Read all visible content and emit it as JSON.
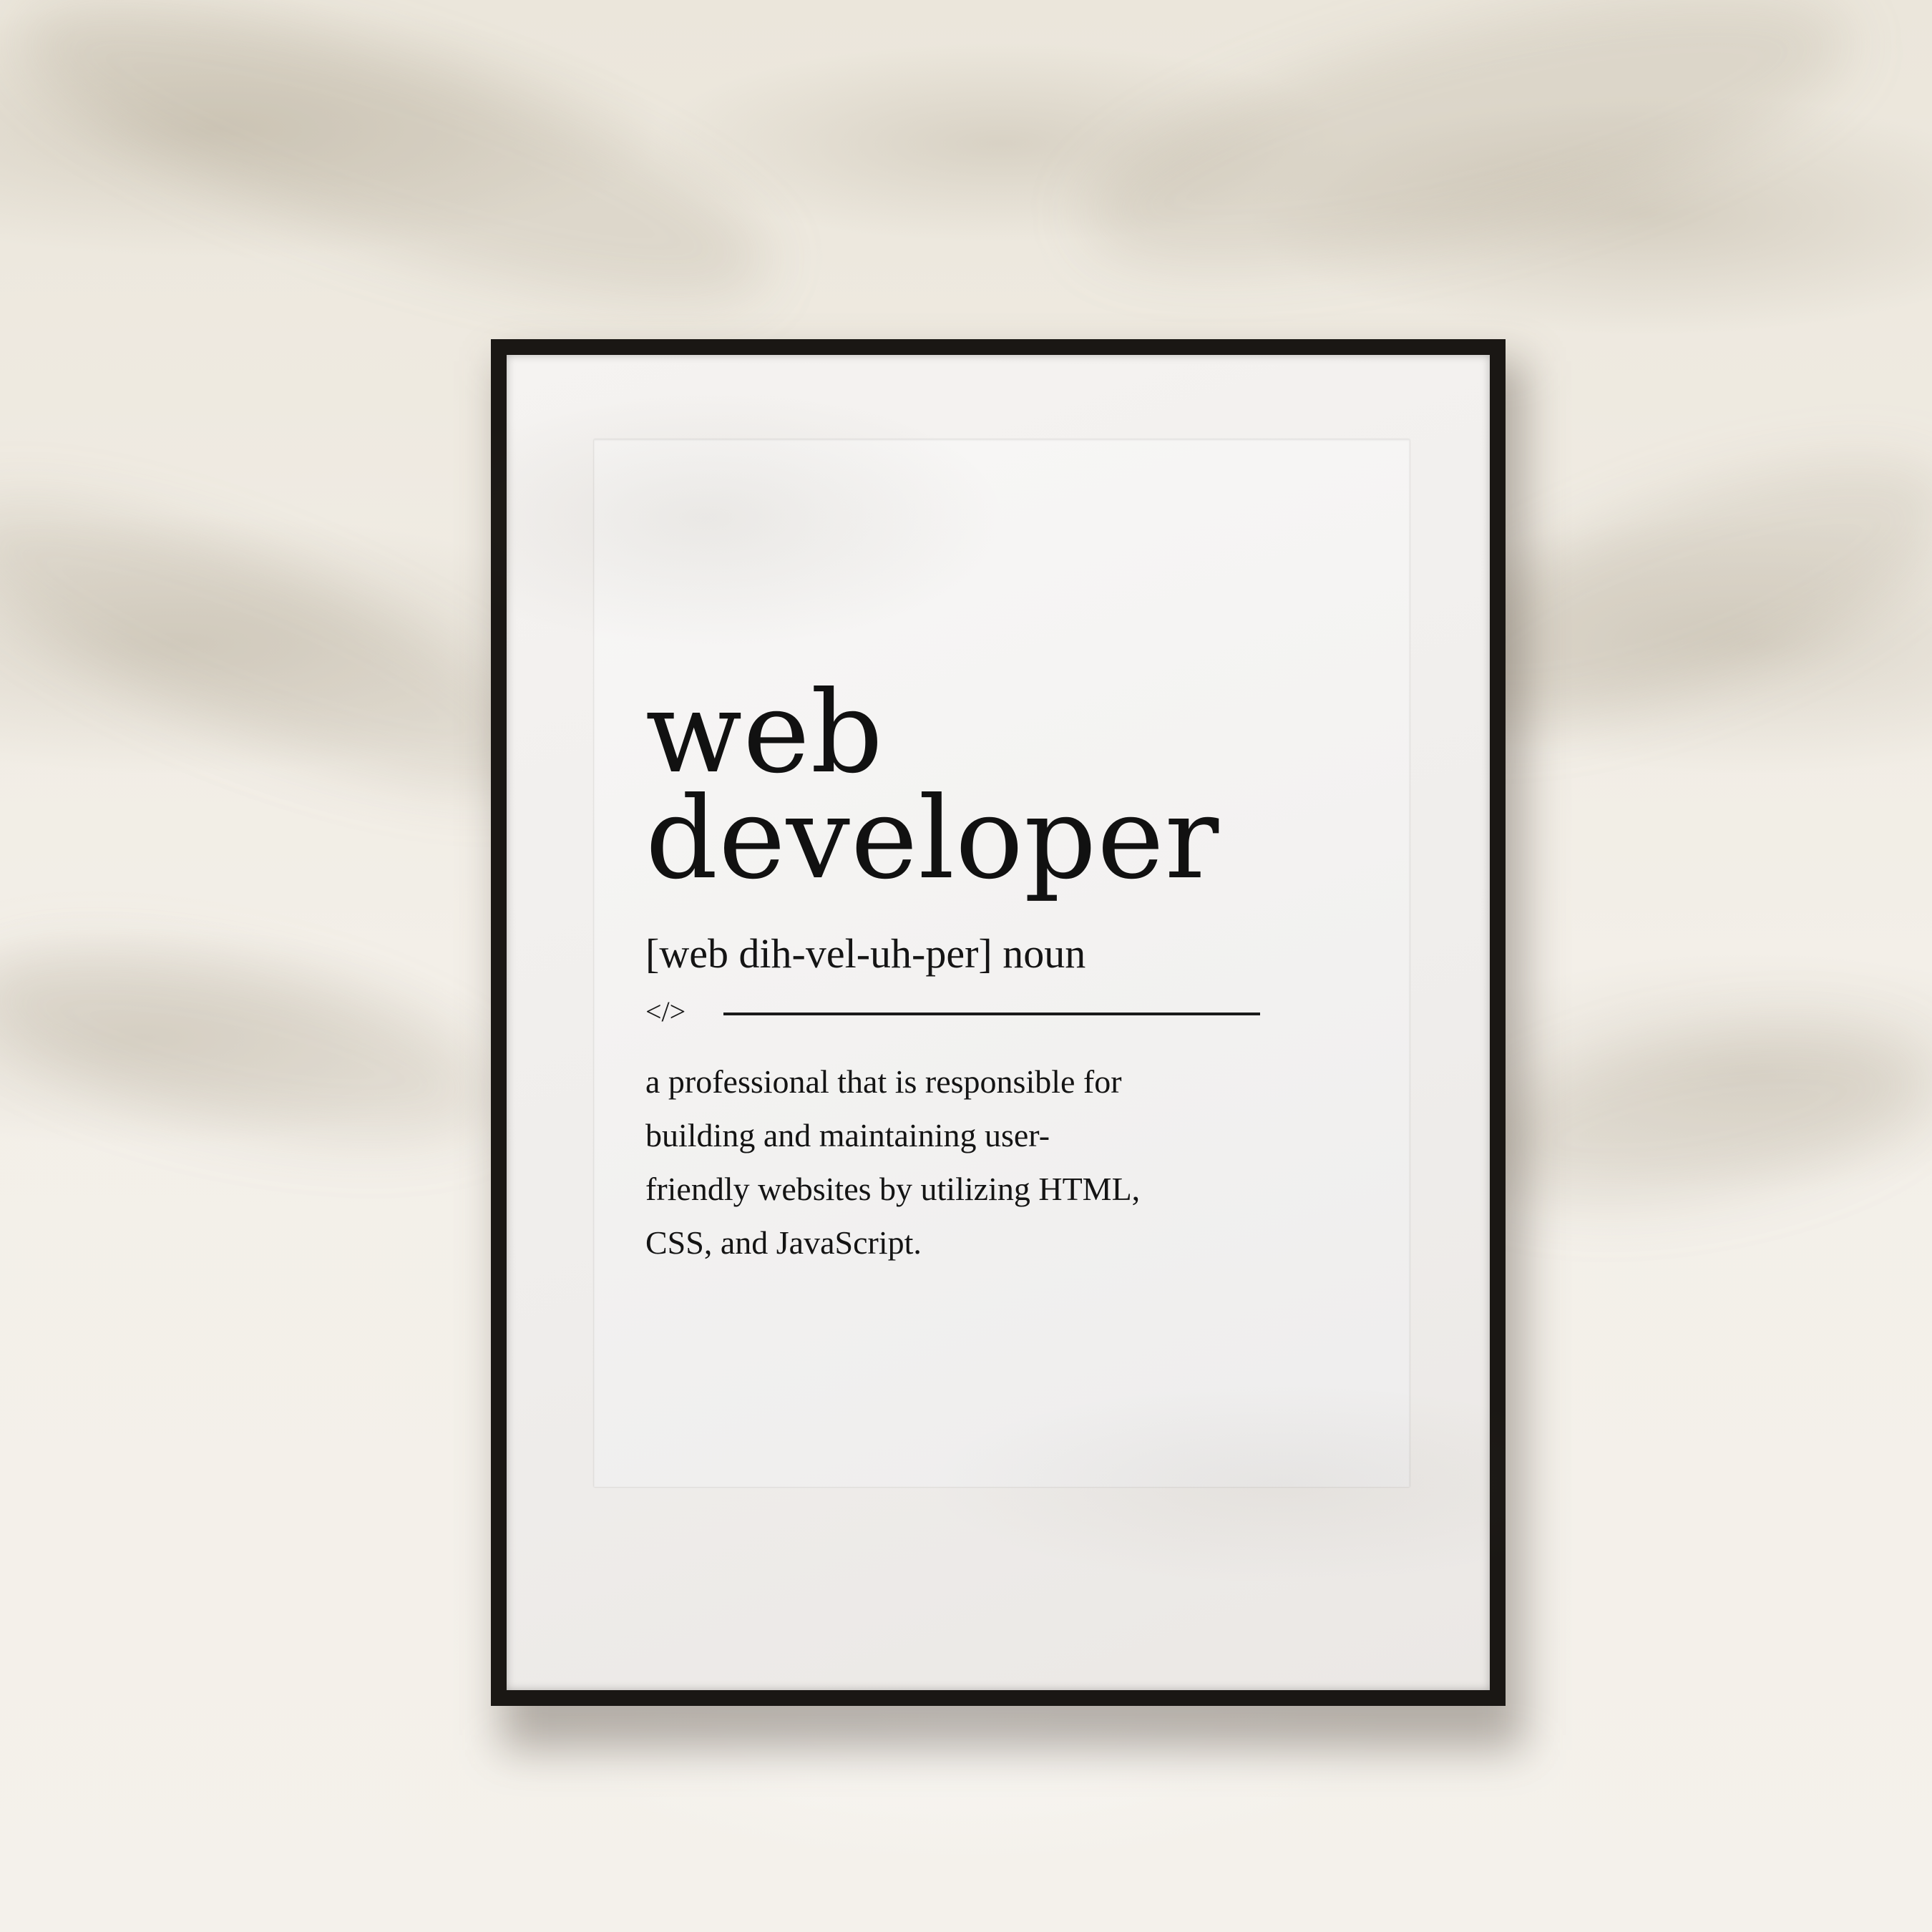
{
  "poster": {
    "title_line1": "web",
    "title_line2": "developer",
    "pronunciation": "[web dih-vel-uh-per] noun",
    "code_symbol": "</>",
    "definition_lines": [
      "a professional that is responsible for",
      "building and maintaining user-",
      "friendly websites by utilizing HTML,",
      "CSS, and JavaScript."
    ]
  },
  "colors": {
    "wall": "#f1ede5",
    "frame": "#1a1714",
    "mat": "#f3f1ef",
    "ink": "#111111"
  }
}
